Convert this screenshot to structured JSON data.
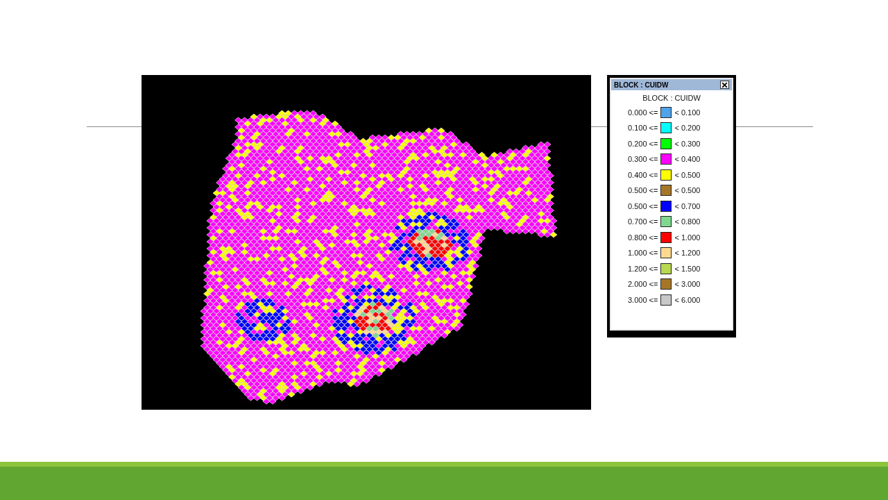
{
  "legend_window": {
    "title": "BLOCK : CUIDW",
    "heading": "BLOCK : CUIDW",
    "items": [
      {
        "low": "0.000 <=",
        "high": "< 0.100",
        "color": "#4fa3e8"
      },
      {
        "low": "0.100 <=",
        "high": "< 0.200",
        "color": "#00ffff"
      },
      {
        "low": "0.200 <=",
        "high": "< 0.300",
        "color": "#00ff00"
      },
      {
        "low": "0.300 <=",
        "high": "< 0.400",
        "color": "#ff00ff"
      },
      {
        "low": "0.400 <=",
        "high": "< 0.500",
        "color": "#ffff00"
      },
      {
        "low": "0.500 <=",
        "high": "< 0.500",
        "color": "#a67628"
      },
      {
        "low": "0.500 <=",
        "high": "< 0.700",
        "color": "#0000ff"
      },
      {
        "low": "0.700 <=",
        "high": "< 0.800",
        "color": "#80d890"
      },
      {
        "low": "0.800 <=",
        "high": "< 1.000",
        "color": "#ff0000"
      },
      {
        "low": "1.000 <=",
        "high": "< 1.200",
        "color": "#ffd890"
      },
      {
        "low": "1.200 <=",
        "high": "< 1.500",
        "color": "#b8d850"
      },
      {
        "low": "2.000 <=",
        "high": "< 3.000",
        "color": "#a67628"
      },
      {
        "low": "3.000 <=",
        "high": "< 6.000",
        "color": "#c8c8c8"
      }
    ]
  }
}
